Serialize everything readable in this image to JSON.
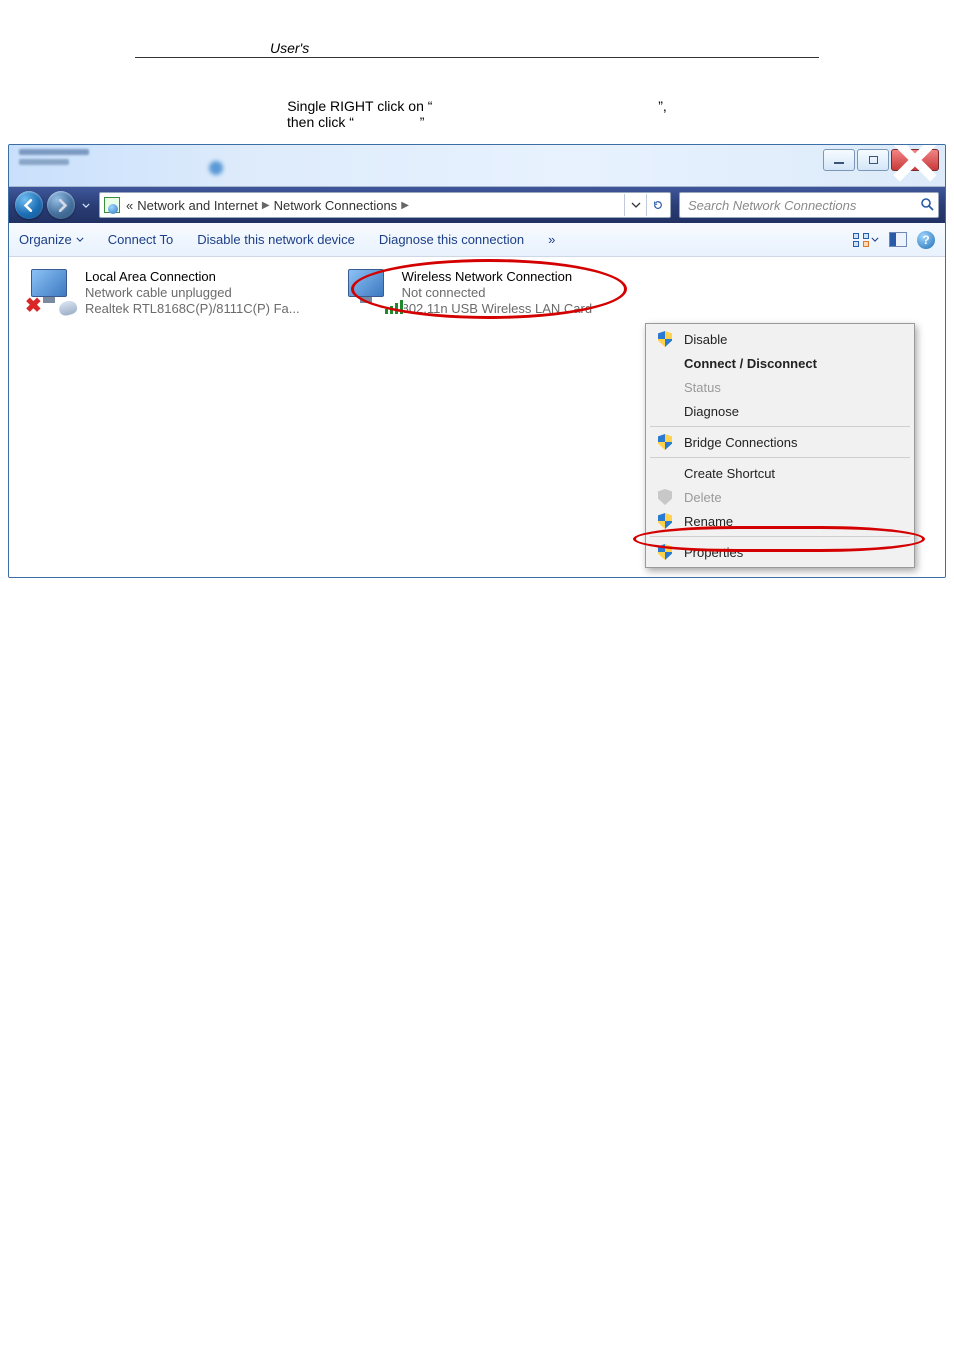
{
  "page_header": {
    "label": "User's"
  },
  "instruction": {
    "line1_a": "Single RIGHT click on “",
    "line1_b": "”,",
    "line2_a": "then click “",
    "line2_b": "”"
  },
  "window": {
    "buttons": {
      "minimize": "_",
      "maximize": "▢",
      "close": "✕"
    },
    "nav": {
      "breadcrumb_prefix": "«",
      "part1": "Network and Internet",
      "part2": "Network Connections",
      "dropdown": "▾"
    },
    "search_placeholder": "Search Network Connections",
    "toolbar": {
      "organize": "Organize",
      "connect_to": "Connect To",
      "disable": "Disable this network device",
      "diagnose": "Diagnose this connection",
      "more": "»",
      "help": "?"
    },
    "connections": {
      "lan": {
        "title": "Local Area Connection",
        "status": "Network cable unplugged",
        "device": "Realtek RTL8168C(P)/8111C(P) Fa..."
      },
      "wlan": {
        "title": "Wireless Network Connection",
        "status": "Not connected",
        "device": "802.11n USB Wireless LAN Card"
      }
    },
    "context_menu": {
      "disable": "Disable",
      "connect": "Connect / Disconnect",
      "status": "Status",
      "diagnose": "Diagnose",
      "bridge": "Bridge Connections",
      "shortcut": "Create Shortcut",
      "delete": "Delete",
      "rename": "Rename",
      "properties": "Properties"
    }
  }
}
